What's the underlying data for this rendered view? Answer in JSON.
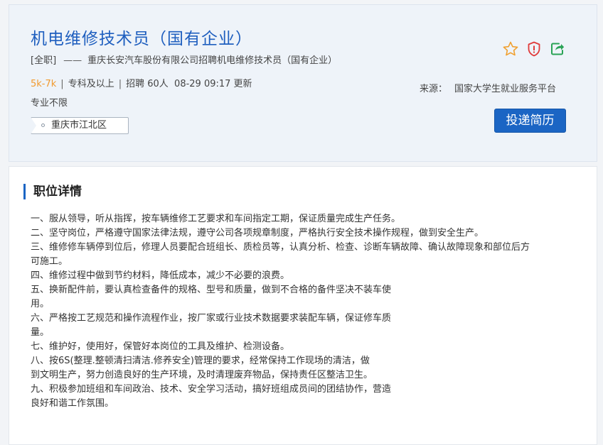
{
  "header": {
    "title": "机电维修技术员（国有企业）",
    "work_type": "[全职]",
    "dash": "——",
    "company_line": "重庆长安汽车股份有限公司招聘机电维修技术员（国有企业）",
    "salary": "5k-7k",
    "separator": "|",
    "education": "专科及以上",
    "headcount": "招聘 60人",
    "updated": "08-29 09:17 更新",
    "major": "专业不限",
    "location": "重庆市江北区",
    "source_label": "来源：",
    "source_value": "国家大学生就业服务平台",
    "apply_label": "投递简历",
    "icons": [
      "star-icon",
      "shield-alert-icon",
      "share-icon"
    ],
    "colors": {
      "accent": "#1b65c4",
      "salary": "#f19a2e",
      "title": "#1f5fbf"
    }
  },
  "details": {
    "section_title": "职位详情",
    "lines": [
      "一、服从领导，听从指挥，按车辆维修工艺要求和车间指定工期，保证质量完成生产任务。",
      "二、坚守岗位，严格遵守国家法律法规，遵守公司各项规章制度，严格执行安全技术操作规程，做到安全生产。",
      "三、维修修车辆停到位后，修理人员要配合班组长、质检员等，认真分析、检查、诊断车辆故障、确认故障现象和部位后方",
      "可施工。",
      "四、维修过程中做到节约材料，降低成本，减少不必要的浪费。",
      "五、换新配件前，要认真检查备件的规格、型号和质量，做到不合格的备件坚决不装车使",
      "用。",
      "六、严格按工艺规范和操作流程作业，按厂家或行业技术数据要求装配车辆，保证修车质",
      "量。",
      "七、维护好，使用好，保管好本岗位的工具及维护、检测设备。",
      "八、按6S(整理.整顿清扫清洁.修养安全)管理的要求，经常保持工作现场的清洁，做",
      "到文明生产，努力创造良好的生产环境，及时清理废弃物品，保持责任区整洁卫生。",
      "九、积极参加班组和车间政治、技术、安全学习活动，搞好班组成员间的团结协作，营造",
      "良好和谐工作氛围。"
    ]
  }
}
